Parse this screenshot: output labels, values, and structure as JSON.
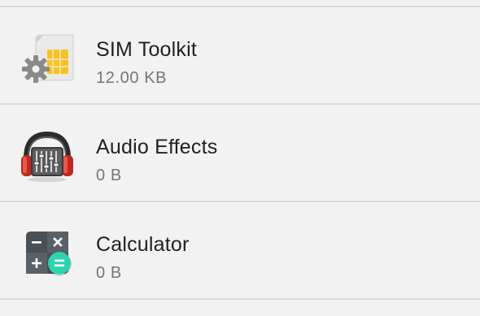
{
  "apps": [
    {
      "name": "SIM Toolkit",
      "size": "12.00 KB",
      "icon": "sim-toolkit-icon"
    },
    {
      "name": "Audio Effects",
      "size": "0 B",
      "icon": "audio-effects-icon"
    },
    {
      "name": "Calculator",
      "size": "0 B",
      "icon": "calculator-icon"
    }
  ],
  "colors": {
    "background": "#f2f2f2",
    "divider": "#d9d9d9",
    "primary_text": "#212121",
    "secondary_text": "#757575",
    "calculator_accent": "#2ed3b0"
  }
}
